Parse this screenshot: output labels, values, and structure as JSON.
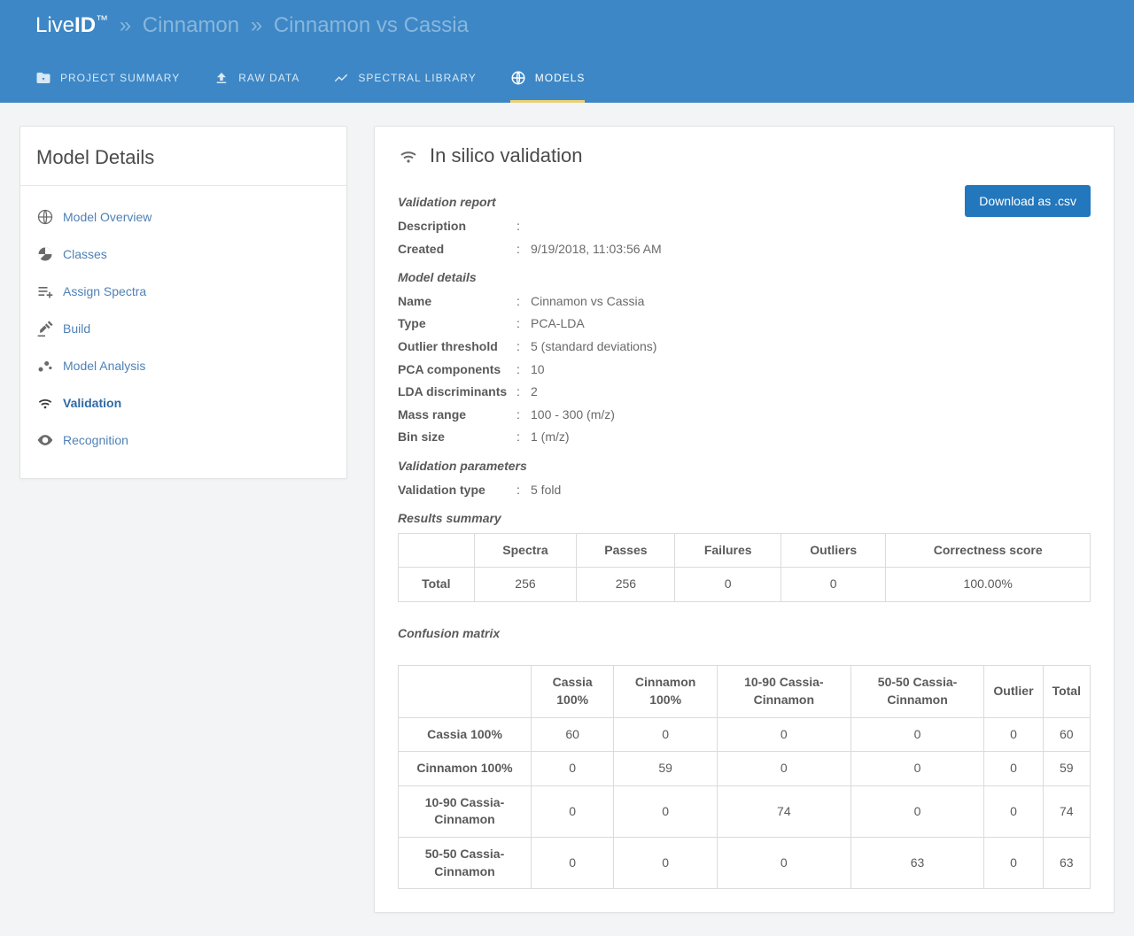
{
  "breadcrumb": {
    "brand_live": "Live",
    "brand_id": "ID",
    "brand_tm": "™",
    "sep": "»",
    "trail1": "Cinnamon",
    "trail2": "Cinnamon vs Cassia"
  },
  "navtabs": [
    {
      "label": "PROJECT SUMMARY",
      "active": false
    },
    {
      "label": "RAW DATA",
      "active": false
    },
    {
      "label": "SPECTRAL LIBRARY",
      "active": false
    },
    {
      "label": "MODELS",
      "active": true
    }
  ],
  "sidebar": {
    "title": "Model Details",
    "items": [
      {
        "label": "Model Overview",
        "icon": "globe",
        "active": false
      },
      {
        "label": "Classes",
        "icon": "pie",
        "active": false
      },
      {
        "label": "Assign Spectra",
        "icon": "list-plus",
        "active": false
      },
      {
        "label": "Build",
        "icon": "gavel",
        "active": false
      },
      {
        "label": "Model Analysis",
        "icon": "scatter",
        "active": false
      },
      {
        "label": "Validation",
        "icon": "wifi",
        "active": true
      },
      {
        "label": "Recognition",
        "icon": "eye",
        "active": false
      }
    ]
  },
  "content": {
    "title": "In silico validation",
    "download_label": "Download as .csv"
  },
  "sections": {
    "validation_report": "Validation report",
    "model_details": "Model details",
    "validation_params": "Validation parameters",
    "results_summary": "Results summary",
    "confusion_matrix": "Confusion matrix"
  },
  "report": {
    "description_k": "Description",
    "description_v": "",
    "created_k": "Created",
    "created_v": "9/19/2018, 11:03:56 AM"
  },
  "model": {
    "name_k": "Name",
    "name_v": "Cinnamon vs Cassia",
    "type_k": "Type",
    "type_v": "PCA-LDA",
    "outlier_k": "Outlier threshold",
    "outlier_v": "5 (standard deviations)",
    "pca_k": "PCA components",
    "pca_v": "10",
    "lda_k": "LDA discriminants",
    "lda_v": "2",
    "mass_k": "Mass range",
    "mass_v": "100 - 300 (m/z)",
    "bin_k": "Bin size",
    "bin_v": "1 (m/z)"
  },
  "params": {
    "vtype_k": "Validation type",
    "vtype_v": "5 fold"
  },
  "summary": {
    "headers": [
      "",
      "Spectra",
      "Passes",
      "Failures",
      "Outliers",
      "Correctness score"
    ],
    "row_label": "Total",
    "row": [
      "256",
      "256",
      "0",
      "0",
      "100.00%"
    ]
  },
  "confusion": {
    "col_headers": [
      "",
      "Cassia 100%",
      "Cinnamon 100%",
      "10-90 Cassia-Cinnamon",
      "50-50 Cassia-Cinnamon",
      "Outlier",
      "Total"
    ],
    "rows": [
      {
        "label": "Cassia 100%",
        "cells": [
          "60",
          "0",
          "0",
          "0",
          "0",
          "60"
        ]
      },
      {
        "label": "Cinnamon 100%",
        "cells": [
          "0",
          "59",
          "0",
          "0",
          "0",
          "59"
        ]
      },
      {
        "label": "10-90 Cassia-Cinnamon",
        "cells": [
          "0",
          "0",
          "74",
          "0",
          "0",
          "74"
        ]
      },
      {
        "label": "50-50 Cassia-Cinnamon",
        "cells": [
          "0",
          "0",
          "0",
          "63",
          "0",
          "63"
        ]
      }
    ]
  }
}
